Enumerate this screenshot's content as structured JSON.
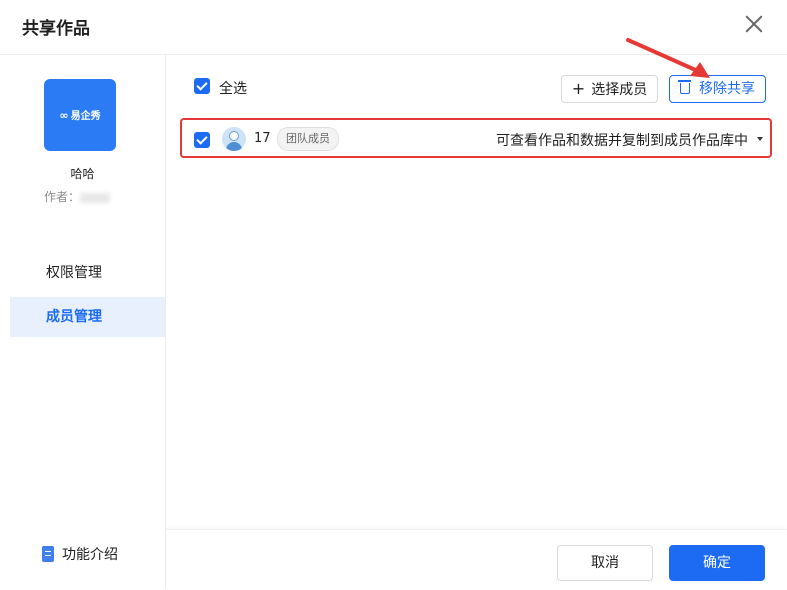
{
  "dialog": {
    "title": "共享作品"
  },
  "sidebar": {
    "logo": {
      "symbol": "∞",
      "text": "易企秀"
    },
    "work_name": "哈哈",
    "author_label": "作者：",
    "nav": [
      {
        "label": "权限管理"
      },
      {
        "label": "成员管理",
        "active": true
      }
    ],
    "feature_intro": "功能介绍"
  },
  "toolbar": {
    "select_all_label": "全选",
    "select_all_checked": true,
    "select_members_label": "选择成员",
    "remove_share_label": "移除共享"
  },
  "members": [
    {
      "name": "17",
      "tag": "团队成员",
      "checked": true,
      "permission": "可查看作品和数据并复制到成员作品库中"
    }
  ],
  "footer": {
    "cancel_label": "取消",
    "confirm_label": "确定"
  },
  "colors": {
    "primary": "#1d6bf2",
    "highlight_border": "#e53935",
    "annotation_arrow": "#e53935"
  },
  "icons": [
    "close-icon",
    "plus-icon",
    "trash-icon",
    "doc-icon",
    "check-icon",
    "caret-down-icon",
    "avatar-icon"
  ]
}
